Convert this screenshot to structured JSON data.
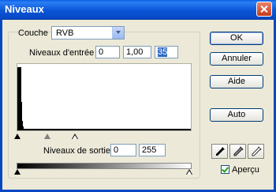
{
  "window": {
    "title": "Niveaux"
  },
  "channel": {
    "label": "Couche :",
    "selected": "RVB"
  },
  "input_levels": {
    "label": "Niveaux d'entrée :",
    "black": "0",
    "gamma": "1,00",
    "white": "35"
  },
  "output_levels": {
    "label": "Niveaux de sortie :",
    "black": "0",
    "white": "255"
  },
  "buttons": {
    "ok": "OK",
    "cancel": "Annuler",
    "help": "Aide",
    "auto": "Auto"
  },
  "preview": {
    "label": "Aperçu",
    "checked": true
  },
  "histogram": {
    "peak_levels": [
      0,
      1,
      2,
      3,
      4,
      5,
      6,
      7
    ],
    "relative_counts": [
      1.0,
      1.0,
      1.0,
      1.0,
      1.0,
      0.45,
      0.15,
      0.06
    ]
  },
  "icons": {
    "close": "close-icon",
    "dropdown": "chevron-down-icon",
    "eyedroppers": [
      "black-eyedropper-icon",
      "gray-eyedropper-icon",
      "white-eyedropper-icon"
    ]
  },
  "colors": {
    "title_bar": "#0b55d8",
    "dialog_bg": "#ece9d8"
  }
}
